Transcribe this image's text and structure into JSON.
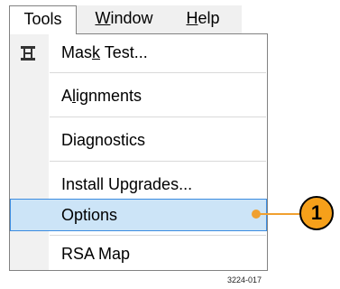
{
  "menubar": {
    "items": [
      {
        "label": "Tools",
        "active": true
      },
      {
        "label_pre": "",
        "label_ul": "W",
        "label_post": "indow"
      },
      {
        "label_pre": "",
        "label_ul": "H",
        "label_post": "elp"
      }
    ]
  },
  "menu": {
    "items": [
      {
        "label_pre": "Mas",
        "label_ul": "k",
        "label_post": " Test...",
        "icon": "mask-test-icon"
      },
      {
        "label_pre": "A",
        "label_ul": "l",
        "label_post": "ignments"
      },
      {
        "label": "Diagnostics"
      },
      {
        "label": "Install Upgrades..."
      },
      {
        "label": "Options",
        "selected": true
      },
      {
        "label": "RSA Map"
      }
    ]
  },
  "callout": {
    "number": "1",
    "color": "#f6a01a"
  },
  "figure_id": "3224-017",
  "colors": {
    "selected_bg": "#cce4f7",
    "selected_border": "#3c8ce0",
    "accent": "#f6a01a"
  }
}
